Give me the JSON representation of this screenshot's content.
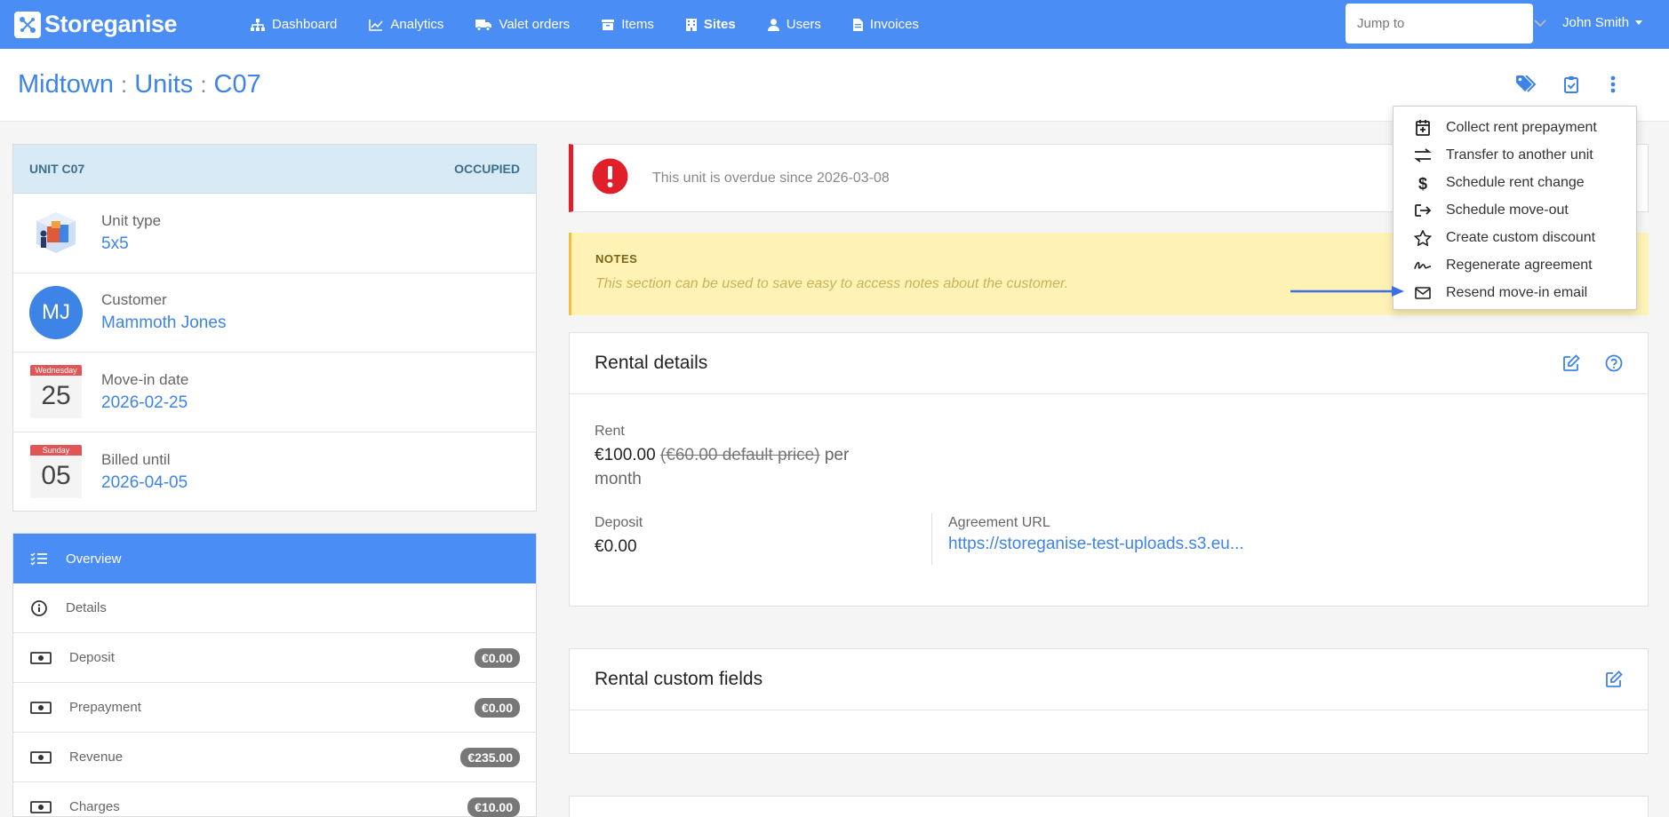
{
  "nav": {
    "brand": "Storeganise",
    "items": [
      {
        "label": "Dashboard",
        "icon": "sitemap-icon"
      },
      {
        "label": "Analytics",
        "icon": "chart-line-icon"
      },
      {
        "label": "Valet orders",
        "icon": "truck-icon"
      },
      {
        "label": "Items",
        "icon": "archive-icon"
      },
      {
        "label": "Sites",
        "icon": "building-icon",
        "active": true
      },
      {
        "label": "Users",
        "icon": "user-icon"
      },
      {
        "label": "Invoices",
        "icon": "file-invoice-icon"
      }
    ],
    "jump_placeholder": "Jump to",
    "user": "John Smith"
  },
  "breadcrumb": [
    "Midtown",
    "Units",
    "C07"
  ],
  "breadcrumb_sep": ":",
  "dropdown": {
    "items": [
      {
        "label": "Collect rent prepayment",
        "icon": "calendar-plus-icon"
      },
      {
        "label": "Transfer to another unit",
        "icon": "exchange-icon"
      },
      {
        "label": "Schedule rent change",
        "icon": "dollar-icon"
      },
      {
        "label": "Schedule move-out",
        "icon": "sign-out-icon"
      },
      {
        "label": "Create custom discount",
        "icon": "star-icon"
      },
      {
        "label": "Regenerate agreement",
        "icon": "signature-icon"
      },
      {
        "label": "Resend move-in email",
        "icon": "envelope-icon"
      }
    ]
  },
  "unit": {
    "title": "UNIT C07",
    "status": "OCCUPIED",
    "type_label": "Unit type",
    "type_value": "5x5",
    "customer_label": "Customer",
    "customer_initials": "MJ",
    "customer_name": "Mammoth Jones",
    "movein_label": "Move-in date",
    "movein_day": "Wednesday",
    "movein_num": "25",
    "movein_value": "2026-02-25",
    "billed_label": "Billed until",
    "billed_day": "Sunday",
    "billed_num": "05",
    "billed_value": "2026-04-05"
  },
  "side_menu": [
    {
      "label": "Overview",
      "icon": "tasks-icon",
      "active": true
    },
    {
      "label": "Details",
      "icon": "info-circle-icon"
    },
    {
      "label": "Deposit",
      "icon": "money-bill-icon",
      "badge": "€0.00"
    },
    {
      "label": "Prepayment",
      "icon": "money-bill-icon",
      "badge": "€0.00"
    },
    {
      "label": "Revenue",
      "icon": "money-bill-icon",
      "badge": "€235.00"
    },
    {
      "label": "Charges",
      "icon": "money-bill-icon",
      "badge": "€10.00"
    }
  ],
  "alert": {
    "text": "This unit is overdue since 2026-03-08"
  },
  "notes": {
    "title": "NOTES",
    "text": "This section can be used to save easy to access notes about the customer."
  },
  "rental": {
    "title": "Rental details",
    "rent_label": "Rent",
    "rent_value": "€100.00",
    "rent_default": "(€60.00 default price)",
    "rent_per": "per",
    "rent_period": "month",
    "deposit_label": "Deposit",
    "deposit_value": "€0.00",
    "agreement_label": "Agreement URL",
    "agreement_value": "https://storeganise-test-uploads.s3.eu..."
  },
  "custom_fields": {
    "title": "Rental custom fields"
  },
  "colors": {
    "primary": "#4a8df5",
    "link": "#3d84e6",
    "danger": "#e01f2a",
    "notes_bg": "#fff2b5"
  }
}
